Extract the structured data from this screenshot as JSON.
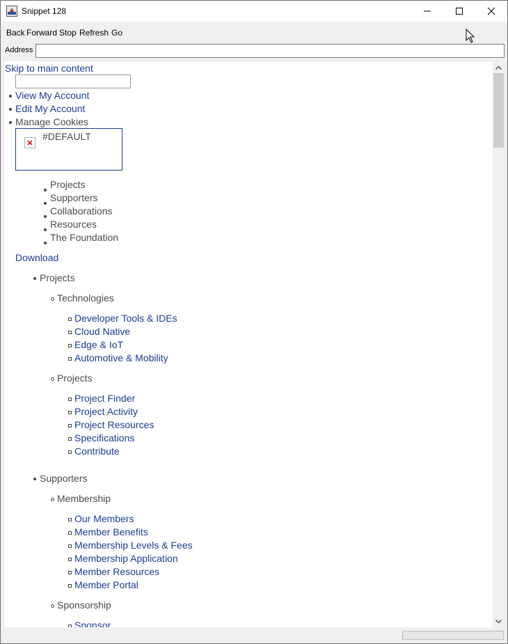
{
  "window": {
    "title": "Snippet 128"
  },
  "toolbar": {
    "back": "Back",
    "forward": "Forward",
    "stop": "Stop",
    "refresh": "Refresh",
    "go": "Go"
  },
  "address": {
    "label": "Address",
    "value": ""
  },
  "page": {
    "skip_link": "Skip to main content",
    "account_links": [
      "View My Account",
      "Edit My Account",
      "Manage Cookies"
    ],
    "logo_alt": "#DEFAULT",
    "top_nav": [
      "Projects",
      "Supporters",
      "Collaborations",
      "Resources",
      "The Foundation"
    ],
    "download": "Download",
    "menu": {
      "projects": {
        "label": "Projects",
        "technologies": {
          "label": "Technologies",
          "items": [
            "Developer Tools & IDEs",
            "Cloud Native",
            "Edge & IoT",
            "Automotive & Mobility"
          ]
        },
        "projects": {
          "label": "Projects",
          "items": [
            "Project Finder",
            "Project Activity",
            "Project Resources",
            "Specifications",
            "Contribute"
          ]
        }
      },
      "supporters": {
        "label": "Supporters",
        "membership": {
          "label": "Membership",
          "items": [
            "Our Members",
            "Member Benefits",
            "Membership Levels & Fees",
            "Membership Application",
            "Member Resources",
            "Member Portal"
          ]
        },
        "sponsorship": {
          "label": "Sponsorship",
          "items": [
            "Sponsor"
          ]
        }
      }
    }
  },
  "colors": {
    "link": "#1a3d8f",
    "text": "#4a4a4a",
    "chrome": "#f0f0f0"
  }
}
